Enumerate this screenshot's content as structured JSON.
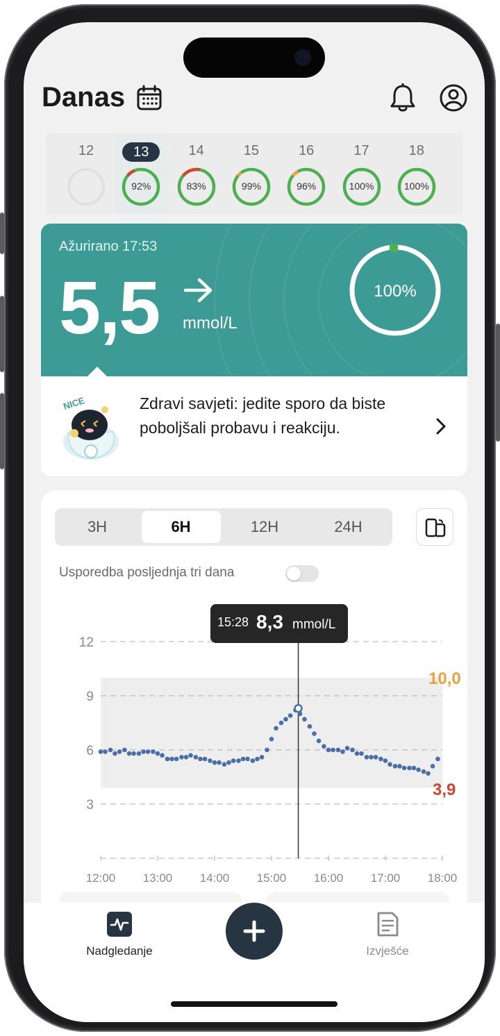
{
  "header": {
    "title": "Danas"
  },
  "dates": [
    {
      "day": "12",
      "percent": "",
      "red": 0,
      "yellow": 0,
      "empty": true
    },
    {
      "day": "13",
      "percent": "92%",
      "red": 0.08,
      "yellow": 0,
      "selected": true
    },
    {
      "day": "14",
      "percent": "83%",
      "red": 0.17,
      "yellow": 0
    },
    {
      "day": "15",
      "percent": "99%",
      "red": 0,
      "yellow": 0.04
    },
    {
      "day": "16",
      "percent": "96%",
      "red": 0,
      "yellow": 0.06
    },
    {
      "day": "17",
      "percent": "100%",
      "red": 0,
      "yellow": 0
    },
    {
      "day": "18",
      "percent": "100%",
      "red": 0,
      "yellow": 0
    }
  ],
  "reading": {
    "updated": "Ažurirano 17:53",
    "value": "5,5",
    "unit": "mmol/L",
    "trend": "right-arrow-icon",
    "in_range": "100%",
    "in_range_fraction": 1.0
  },
  "tip": {
    "text": "Zdravi savjeti: jedite sporo da biste poboljšali probavu i reakciju.",
    "mascot_badge": "NICE"
  },
  "ranges": {
    "tabs": [
      "3H",
      "6H",
      "12H",
      "24H"
    ],
    "active": "6H"
  },
  "compare": {
    "label": "Usporedba posljednja tri dana",
    "enabled": false
  },
  "tooltip": {
    "time": "15:28",
    "value": "8,3",
    "unit": "mmol/L"
  },
  "targets": {
    "high": "10,0",
    "low": "3,9"
  },
  "colors": {
    "accent": "#3d9b95",
    "in_range": "#4caf50",
    "low": "#d0462f",
    "high": "#e9a33a",
    "series": "#4a6ea8",
    "dark": "#273543"
  },
  "chart_data": {
    "type": "scatter",
    "x_ticks": [
      "12:00",
      "13:00",
      "14:00",
      "15:00",
      "16:00",
      "17:00",
      "18:00"
    ],
    "y_ticks": [
      3,
      6,
      9,
      12
    ],
    "ylim": [
      0,
      12
    ],
    "xlim_hours": [
      12,
      18
    ],
    "target_band": [
      3.9,
      10.0
    ],
    "cursor": {
      "x": 15.47,
      "y": 8.3
    },
    "series": [
      {
        "values": [
          [
            12.0,
            5.9
          ],
          [
            12.08,
            5.9
          ],
          [
            12.17,
            6.0
          ],
          [
            12.25,
            5.8
          ],
          [
            12.33,
            5.9
          ],
          [
            12.42,
            6.0
          ],
          [
            12.5,
            5.8
          ],
          [
            12.58,
            5.8
          ],
          [
            12.67,
            5.8
          ],
          [
            12.75,
            5.9
          ],
          [
            12.83,
            5.9
          ],
          [
            12.92,
            5.9
          ],
          [
            13.0,
            5.8
          ],
          [
            13.08,
            5.7
          ],
          [
            13.17,
            5.5
          ],
          [
            13.25,
            5.5
          ],
          [
            13.33,
            5.5
          ],
          [
            13.42,
            5.6
          ],
          [
            13.5,
            5.6
          ],
          [
            13.58,
            5.7
          ],
          [
            13.67,
            5.6
          ],
          [
            13.75,
            5.5
          ],
          [
            13.83,
            5.5
          ],
          [
            13.92,
            5.4
          ],
          [
            14.0,
            5.3
          ],
          [
            14.08,
            5.3
          ],
          [
            14.17,
            5.2
          ],
          [
            14.25,
            5.3
          ],
          [
            14.33,
            5.4
          ],
          [
            14.42,
            5.4
          ],
          [
            14.5,
            5.5
          ],
          [
            14.58,
            5.5
          ],
          [
            14.67,
            5.4
          ],
          [
            14.75,
            5.5
          ],
          [
            14.83,
            5.6
          ],
          [
            14.92,
            6.0
          ],
          [
            15.0,
            6.6
          ],
          [
            15.08,
            7.2
          ],
          [
            15.17,
            7.5
          ],
          [
            15.25,
            7.7
          ],
          [
            15.33,
            7.9
          ],
          [
            15.42,
            8.2
          ],
          [
            15.5,
            8.0
          ],
          [
            15.58,
            7.7
          ],
          [
            15.67,
            7.3
          ],
          [
            15.75,
            6.9
          ],
          [
            15.83,
            6.5
          ],
          [
            15.92,
            6.2
          ],
          [
            16.0,
            6.0
          ],
          [
            16.08,
            6.0
          ],
          [
            16.17,
            6.0
          ],
          [
            16.25,
            5.9
          ],
          [
            16.33,
            6.1
          ],
          [
            16.42,
            6.0
          ],
          [
            16.5,
            5.8
          ],
          [
            16.58,
            5.8
          ],
          [
            16.67,
            5.6
          ],
          [
            16.75,
            5.6
          ],
          [
            16.83,
            5.6
          ],
          [
            16.92,
            5.5
          ],
          [
            17.0,
            5.4
          ],
          [
            17.08,
            5.2
          ],
          [
            17.17,
            5.1
          ],
          [
            17.25,
            5.1
          ],
          [
            17.33,
            5.0
          ],
          [
            17.42,
            5.0
          ],
          [
            17.5,
            5.0
          ],
          [
            17.58,
            4.9
          ],
          [
            17.67,
            4.8
          ],
          [
            17.75,
            4.7
          ],
          [
            17.83,
            5.1
          ],
          [
            17.92,
            5.5
          ]
        ]
      }
    ]
  },
  "tabbar": {
    "monitor": {
      "label": "Nadgledanje",
      "icon": "pulse-icon",
      "active": true
    },
    "add": {
      "icon": "plus-icon"
    },
    "reports": {
      "label": "Izvješće",
      "icon": "report-icon",
      "active": false
    }
  }
}
